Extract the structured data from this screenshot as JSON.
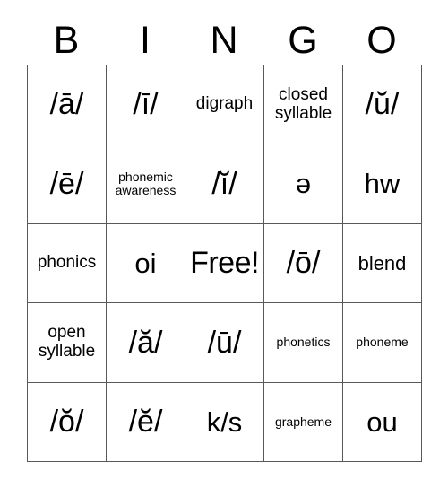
{
  "card": {
    "title": "BINGO",
    "header_letters": [
      "B",
      "I",
      "N",
      "G",
      "O"
    ],
    "free_space_label": "Free!",
    "grid": {
      "columns": 5,
      "rows": 5,
      "border_color": "#595959",
      "background_color": "#ffffff",
      "text_color": "#000000"
    },
    "cells": [
      [
        {
          "text": "/ā/",
          "size": "xl"
        },
        {
          "text": "/ī/",
          "size": "xl"
        },
        {
          "text": "digraph",
          "size": "sm"
        },
        {
          "text": "closed\nsyllable",
          "size": "sm"
        },
        {
          "text": "/ŭ/",
          "size": "xl"
        }
      ],
      [
        {
          "text": "/ē/",
          "size": "xl"
        },
        {
          "text": "phonemic\nawareness",
          "size": "xs"
        },
        {
          "text": "/ĭ/",
          "size": "xl"
        },
        {
          "text": "ə",
          "size": "lg"
        },
        {
          "text": "hw",
          "size": "lg"
        }
      ],
      [
        {
          "text": "phonics",
          "size": "sm"
        },
        {
          "text": "oi",
          "size": "lg"
        },
        {
          "text": "Free!",
          "size": "free"
        },
        {
          "text": "/ō/",
          "size": "xl"
        },
        {
          "text": "blend",
          "size": "md"
        }
      ],
      [
        {
          "text": "open\nsyllable",
          "size": "sm"
        },
        {
          "text": "/ă/",
          "size": "xl"
        },
        {
          "text": "/ū/",
          "size": "xl"
        },
        {
          "text": "phonetics",
          "size": "xs"
        },
        {
          "text": "phoneme",
          "size": "xs"
        }
      ],
      [
        {
          "text": "/ŏ/",
          "size": "xl"
        },
        {
          "text": "/ĕ/",
          "size": "xl"
        },
        {
          "text": "k/s",
          "size": "lg"
        },
        {
          "text": "grapheme",
          "size": "xs"
        },
        {
          "text": "ou",
          "size": "lg"
        }
      ]
    ]
  }
}
